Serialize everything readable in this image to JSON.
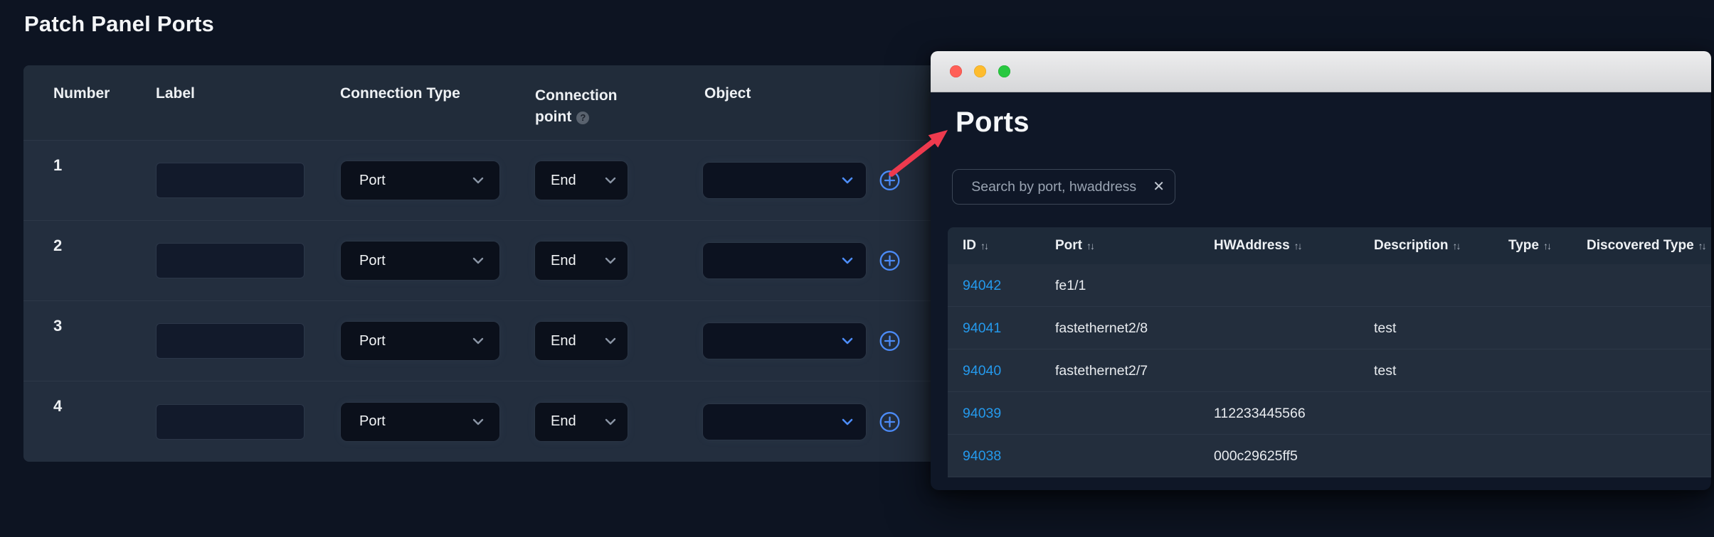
{
  "page": {
    "title": "Patch Panel Ports",
    "table": {
      "headers": {
        "number": "Number",
        "label": "Label",
        "connection_type": "Connection Type",
        "connection_point": "Connection point",
        "object": "Object"
      },
      "help_glyph": "?",
      "rows": [
        {
          "number": "1",
          "label_value": "",
          "connection_type": "Port",
          "connection_point": "End",
          "object_value": ""
        },
        {
          "number": "2",
          "label_value": "",
          "connection_type": "Port",
          "connection_point": "End",
          "object_value": ""
        },
        {
          "number": "3",
          "label_value": "",
          "connection_type": "Port",
          "connection_point": "End",
          "object_value": ""
        },
        {
          "number": "4",
          "label_value": "",
          "connection_type": "Port",
          "connection_point": "End",
          "object_value": ""
        }
      ]
    }
  },
  "modal": {
    "title": "Ports",
    "search": {
      "placeholder": "Search by port, hwaddress",
      "clear_glyph": "✕"
    },
    "table": {
      "sort_icon": "↑↓",
      "headers": [
        "ID",
        "Port",
        "HWAddress",
        "Description",
        "Type",
        "Discovered Type"
      ],
      "rows": [
        {
          "id": "94042",
          "port": "fe1/1",
          "hwaddress": "",
          "description": "",
          "type": "",
          "discovered_type": ""
        },
        {
          "id": "94041",
          "port": "fastethernet2/8",
          "hwaddress": "",
          "description": "test",
          "type": "",
          "discovered_type": ""
        },
        {
          "id": "94040",
          "port": "fastethernet2/7",
          "hwaddress": "",
          "description": "test",
          "type": "",
          "discovered_type": ""
        },
        {
          "id": "94039",
          "port": "",
          "hwaddress": "112233445566",
          "description": "",
          "type": "",
          "discovered_type": ""
        },
        {
          "id": "94038",
          "port": "",
          "hwaddress": "000c29625ff5",
          "description": "",
          "type": "",
          "discovered_type": ""
        }
      ]
    }
  },
  "colors": {
    "accent_blue": "#4d8dfa",
    "link_blue": "#2499ec",
    "arrow_red": "#ee3a4e",
    "traffic_red": "#ff5f57",
    "traffic_yellow": "#febc2e",
    "traffic_green": "#28c840"
  }
}
